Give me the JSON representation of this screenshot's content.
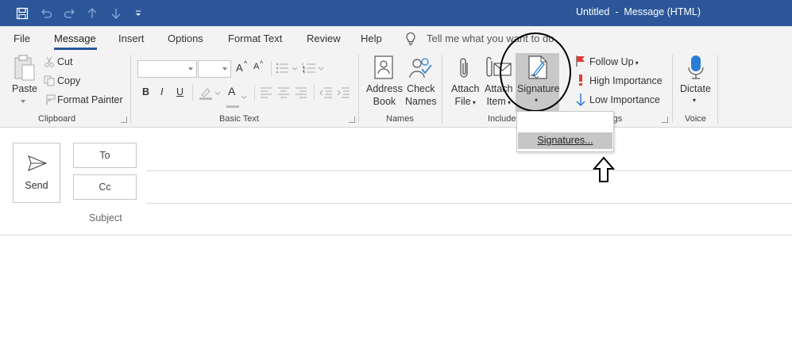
{
  "window": {
    "title": "Untitled  -  Message (HTML)",
    "accent_color": "#2b579a"
  },
  "quick_access": {
    "icons": [
      "save-icon",
      "undo-icon",
      "redo-icon",
      "up-arrow-icon",
      "down-arrow-icon",
      "customize-icon"
    ]
  },
  "menu": {
    "tabs": [
      "File",
      "Message",
      "Insert",
      "Options",
      "Format Text",
      "Review",
      "Help"
    ],
    "active": "Message",
    "tell_me": "Tell me what you want to do"
  },
  "ribbon": {
    "clipboard": {
      "group": "Clipboard",
      "paste": "Paste",
      "cut": "Cut",
      "copy": "Copy",
      "format_painter": "Format Painter"
    },
    "basic_text": {
      "group": "Basic Text",
      "bold": "B",
      "italic": "I",
      "underline": "U",
      "grow_font": "A",
      "shrink_font": "A",
      "font_color": "A"
    },
    "names": {
      "group": "Names",
      "address_book": [
        "Address",
        "Book"
      ],
      "check_names": [
        "Check",
        "Names"
      ]
    },
    "include": {
      "group": "Include",
      "attach_file": [
        "Attach",
        "File"
      ],
      "attach_item": [
        "Attach",
        "Item"
      ],
      "signature": "Signature"
    },
    "tags": {
      "group": "Tags",
      "follow_up": "Follow Up",
      "high_importance": "High Importance",
      "low_importance": "Low Importance"
    },
    "voice": {
      "group": "Voice",
      "dictate": "Dictate"
    }
  },
  "compose": {
    "send": "Send",
    "to": "To",
    "cc": "Cc",
    "subject": "Subject"
  },
  "signature_menu": {
    "items": [
      "Signatures..."
    ]
  }
}
